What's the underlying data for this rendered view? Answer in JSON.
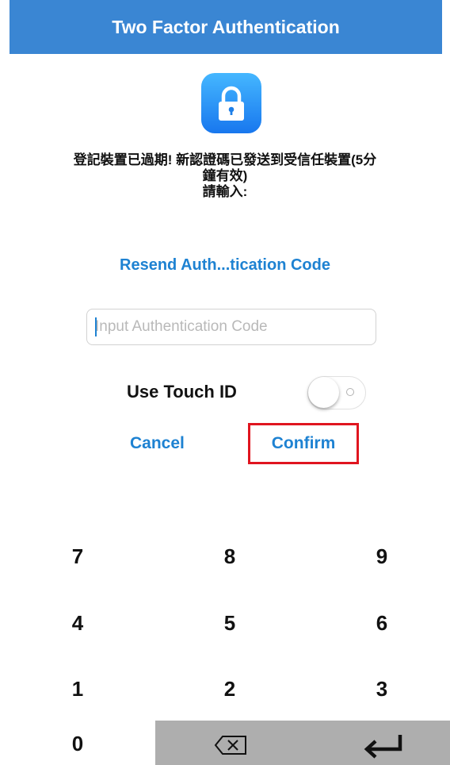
{
  "header": {
    "title": "Two Factor Authentication"
  },
  "app_icon": {
    "icon": "lock-icon",
    "gradient_top": "#45b7ff",
    "gradient_bottom": "#1877ee"
  },
  "message": {
    "line1": "登記裝置已過期! 新認證碼已發送到受信任裝置(5分",
    "line2": "鐘有效)",
    "line3": "請輸入:"
  },
  "resend": {
    "label": "Resend Auth...tication Code"
  },
  "code_input": {
    "placeholder": "Input Authentication Code",
    "value": ""
  },
  "touch_id": {
    "label": "Use Touch ID",
    "enabled": false
  },
  "actions": {
    "cancel_label": "Cancel",
    "confirm_label": "Confirm"
  },
  "keypad": {
    "rows": [
      [
        "7",
        "8",
        "9"
      ],
      [
        "4",
        "5",
        "6"
      ],
      [
        "1",
        "2",
        "3"
      ],
      [
        "0",
        "delete-icon",
        "return-icon"
      ]
    ]
  },
  "colors": {
    "header": "#3a86d3",
    "accent": "#1e82d2",
    "highlight": "#e0151f"
  }
}
